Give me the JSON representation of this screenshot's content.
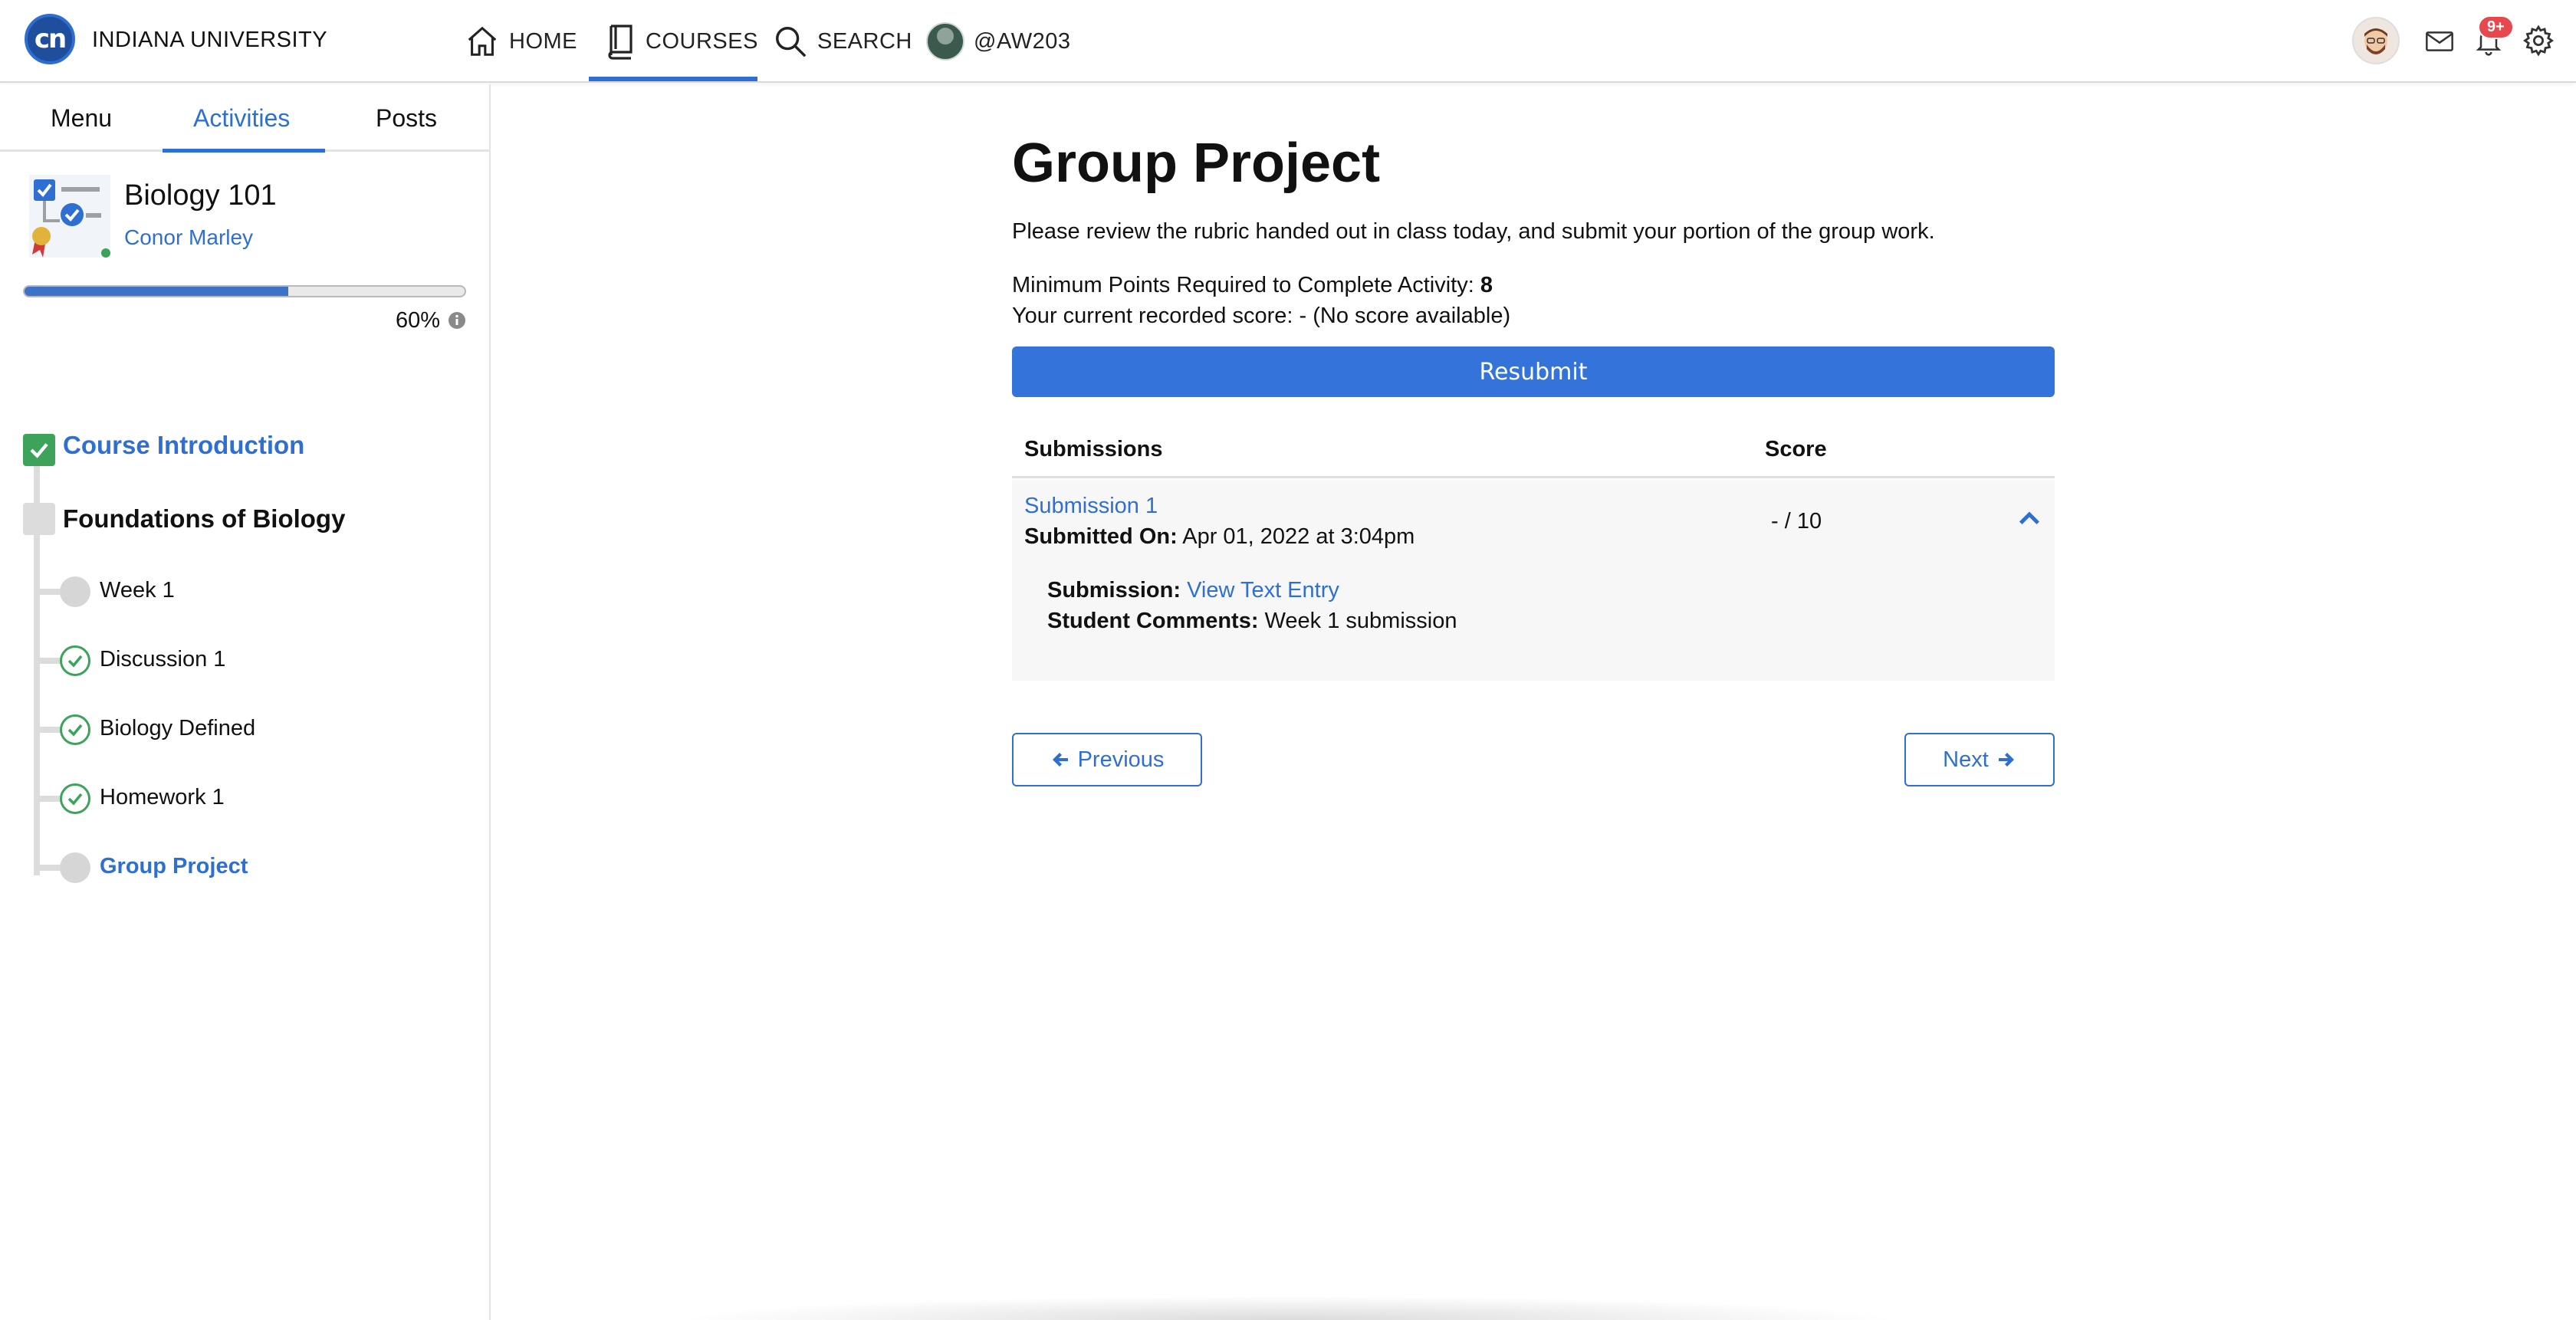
{
  "header": {
    "org_name": "INDIANA UNIVERSITY",
    "logo_text": "cn",
    "nav": {
      "home": "HOME",
      "courses": "COURSES",
      "search": "SEARCH",
      "user": "@AW203"
    },
    "notification_count": "9+"
  },
  "sidebar": {
    "tabs": {
      "menu": "Menu",
      "activities": "Activities",
      "posts": "Posts"
    },
    "course": {
      "title": "Biology 101",
      "owner": "Conor Marley"
    },
    "progress": {
      "value": 0.6,
      "label": "60%"
    },
    "sections": [
      {
        "label": "Course Introduction",
        "status": "complete"
      },
      {
        "label": "Foundations of Biology",
        "status": "incomplete"
      }
    ],
    "items": [
      {
        "label": "Week 1",
        "status": "incomplete"
      },
      {
        "label": "Discussion 1",
        "status": "complete"
      },
      {
        "label": "Biology Defined",
        "status": "complete"
      },
      {
        "label": "Homework 1",
        "status": "complete"
      },
      {
        "label": "Group Project",
        "status": "current"
      }
    ]
  },
  "main": {
    "title": "Group Project",
    "description": "Please review the rubric handed out in class today, and submit your portion of the group work.",
    "min_points_label": "Minimum Points Required to Complete Activity:",
    "min_points_value": "8",
    "current_score": "Your current recorded score: - (No score available)",
    "resubmit_label": "Resubmit",
    "table": {
      "col_submissions": "Submissions",
      "col_score": "Score"
    },
    "submission": {
      "name": "Submission 1",
      "submitted_on_label": "Submitted On:",
      "submitted_on_value": "Apr 01, 2022 at 3:04pm",
      "score": "- / 10",
      "entry_label": "Submission:",
      "entry_link": "View Text Entry",
      "comments_label": "Student Comments:",
      "comments_value": "Week 1 submission"
    },
    "prev_label": "Previous",
    "next_label": "Next"
  },
  "colors": {
    "accent": "#2f6fd2",
    "button": "#3473d9",
    "success": "#3da35a",
    "badge": "#e5484d"
  }
}
